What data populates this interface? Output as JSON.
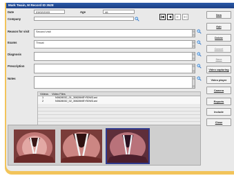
{
  "window": {
    "title": "Mark Twain, M Record ID 3528"
  },
  "form": {
    "date_label": "Date",
    "date_value": "03/02/2003",
    "age_label": "Age",
    "age_value": "46",
    "company_label": "Company",
    "company_value": "",
    "reason_label": "Reason for visit",
    "reason_value": "Second visit",
    "exams_label": "Exams",
    "exams_value": "Throat",
    "diagnosis_label": "Diagnosis",
    "diagnosis_value": "",
    "prescription_label": "Prescription",
    "prescription_value": "",
    "notes_label": "Notes",
    "notes_value": ""
  },
  "navigation": {
    "icons": [
      "first-record-icon",
      "previous-record-icon",
      "next-record-icon",
      "last-record-icon"
    ]
  },
  "buttons": {
    "new": "New",
    "edit": "Edit",
    "delete": "Delete",
    "cancel": "Cancel",
    "save": "Save",
    "video_capturing": "Video capturing",
    "video_player": "Video player",
    "camera": "Camera",
    "reports": "Reports",
    "include": "Include",
    "close": "Close"
  },
  "videos": {
    "headers": [
      "Videos",
      "Video Files"
    ],
    "rows": [
      {
        "num": "1",
        "file": "N0628032_01_30828MEYS0W3.avi"
      },
      {
        "num": "2",
        "file": "N0628032_02_30828MEYS0W3.avi"
      }
    ]
  },
  "colors": {
    "frame": "#f2c45a",
    "titlebar": "#1d3f84",
    "selected_thumb": "#2f3a8e"
  }
}
